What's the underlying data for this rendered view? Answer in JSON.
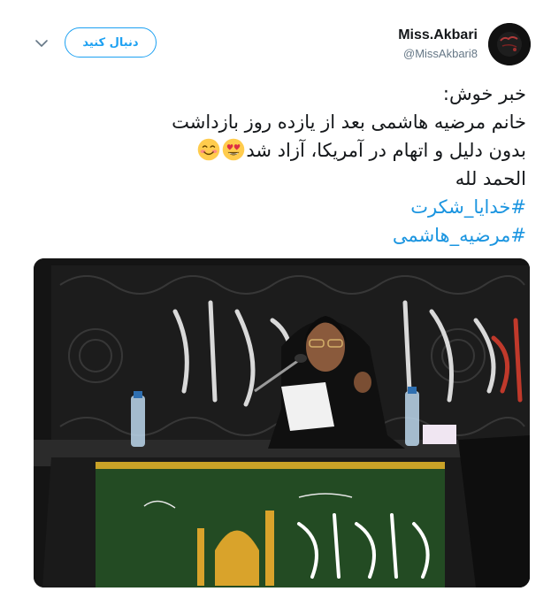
{
  "author": {
    "display_name": "Miss.Akbari",
    "handle": "@MissAkbari8"
  },
  "actions": {
    "follow_label": "دنبال کنید"
  },
  "tweet": {
    "lines": [
      "خبر خوش:",
      "خانم مرضیه هاشمی بعد از یازده روز بازداشت",
      "بدون دلیل و اتهام در آمریکا، آزاد شد",
      "الحمد لله"
    ],
    "hashtags": [
      "#خدایا_شکرت",
      "#مرضیه_هاشمی"
    ],
    "emojis": [
      "heart-eyes-emoji",
      "smiling-face-emoji"
    ]
  },
  "media": {
    "banner_text": "السلام علیک یا اباعبدالله",
    "background_calligraphy": "صبر جمیل سفینة النجاة"
  },
  "colors": {
    "accent": "#1da1f2",
    "hashtag": "#1b95e0",
    "text": "#14171a",
    "secondary": "#657786"
  }
}
